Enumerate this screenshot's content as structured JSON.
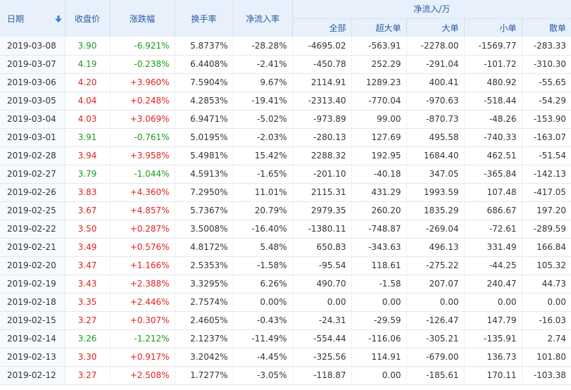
{
  "header": {
    "date": "日期",
    "close": "收盘价",
    "change": "涨跌幅",
    "turnover": "换手率",
    "ratio": "净流入率",
    "flow_group": "净流入/万",
    "flow_cols": [
      "全部",
      "超大单",
      "大单",
      "小单",
      "散单"
    ]
  },
  "rows": [
    {
      "date": "2019-03-08",
      "close": "3.90",
      "change": "-6.921%",
      "dir": "down",
      "turnover": "5.8737%",
      "ratio": "-28.28%",
      "all": "-4695.02",
      "xl": "-563.91",
      "l": "-2278.00",
      "s": "-1569.77",
      "r": "-283.33"
    },
    {
      "date": "2019-03-07",
      "close": "4.19",
      "change": "-0.238%",
      "dir": "down",
      "turnover": "6.4408%",
      "ratio": "-2.41%",
      "all": "-450.78",
      "xl": "252.29",
      "l": "-291.04",
      "s": "-101.72",
      "r": "-310.30"
    },
    {
      "date": "2019-03-06",
      "close": "4.20",
      "change": "+3.960%",
      "dir": "up",
      "turnover": "7.5904%",
      "ratio": "9.67%",
      "all": "2114.91",
      "xl": "1289.23",
      "l": "400.41",
      "s": "480.92",
      "r": "-55.65"
    },
    {
      "date": "2019-03-05",
      "close": "4.04",
      "change": "+0.248%",
      "dir": "up",
      "turnover": "4.2853%",
      "ratio": "-19.41%",
      "all": "-2313.40",
      "xl": "-770.04",
      "l": "-970.63",
      "s": "-518.44",
      "r": "-54.29"
    },
    {
      "date": "2019-03-04",
      "close": "4.03",
      "change": "+3.069%",
      "dir": "up",
      "turnover": "6.9471%",
      "ratio": "-5.02%",
      "all": "-973.89",
      "xl": "99.00",
      "l": "-870.73",
      "s": "-48.26",
      "r": "-153.90"
    },
    {
      "date": "2019-03-01",
      "close": "3.91",
      "change": "-0.761%",
      "dir": "down",
      "turnover": "5.0195%",
      "ratio": "-2.03%",
      "all": "-280.13",
      "xl": "127.69",
      "l": "495.58",
      "s": "-740.33",
      "r": "-163.07"
    },
    {
      "date": "2019-02-28",
      "close": "3.94",
      "change": "+3.958%",
      "dir": "up",
      "turnover": "5.4981%",
      "ratio": "15.42%",
      "all": "2288.32",
      "xl": "192.95",
      "l": "1684.40",
      "s": "462.51",
      "r": "-51.54"
    },
    {
      "date": "2019-02-27",
      "close": "3.79",
      "change": "-1.044%",
      "dir": "down",
      "turnover": "4.5913%",
      "ratio": "-1.65%",
      "all": "-201.10",
      "xl": "-40.18",
      "l": "347.05",
      "s": "-365.84",
      "r": "-142.13"
    },
    {
      "date": "2019-02-26",
      "close": "3.83",
      "change": "+4.360%",
      "dir": "up",
      "turnover": "7.2950%",
      "ratio": "11.01%",
      "all": "2115.31",
      "xl": "431.29",
      "l": "1993.59",
      "s": "107.48",
      "r": "-417.05"
    },
    {
      "date": "2019-02-25",
      "close": "3.67",
      "change": "+4.857%",
      "dir": "up",
      "turnover": "5.7367%",
      "ratio": "20.79%",
      "all": "2979.35",
      "xl": "260.20",
      "l": "1835.29",
      "s": "686.67",
      "r": "197.20"
    },
    {
      "date": "2019-02-22",
      "close": "3.50",
      "change": "+0.287%",
      "dir": "up",
      "turnover": "3.5008%",
      "ratio": "-16.40%",
      "all": "-1380.11",
      "xl": "-748.87",
      "l": "-269.04",
      "s": "-72.61",
      "r": "-289.59"
    },
    {
      "date": "2019-02-21",
      "close": "3.49",
      "change": "+0.576%",
      "dir": "up",
      "turnover": "4.8172%",
      "ratio": "5.48%",
      "all": "650.83",
      "xl": "-343.63",
      "l": "496.13",
      "s": "331.49",
      "r": "166.84"
    },
    {
      "date": "2019-02-20",
      "close": "3.47",
      "change": "+1.166%",
      "dir": "up",
      "turnover": "2.5353%",
      "ratio": "-1.58%",
      "all": "-95.54",
      "xl": "118.61",
      "l": "-275.22",
      "s": "-44.25",
      "r": "105.32"
    },
    {
      "date": "2019-02-19",
      "close": "3.43",
      "change": "+2.388%",
      "dir": "up",
      "turnover": "3.3295%",
      "ratio": "6.26%",
      "all": "490.70",
      "xl": "-1.58",
      "l": "207.07",
      "s": "240.47",
      "r": "44.73"
    },
    {
      "date": "2019-02-18",
      "close": "3.35",
      "change": "+2.446%",
      "dir": "up",
      "turnover": "2.7574%",
      "ratio": "0.00%",
      "all": "0.00",
      "xl": "0.00",
      "l": "0.00",
      "s": "0.00",
      "r": "0.00"
    },
    {
      "date": "2019-02-15",
      "close": "3.27",
      "change": "+0.307%",
      "dir": "up",
      "turnover": "2.4605%",
      "ratio": "-0.43%",
      "all": "-24.31",
      "xl": "-29.59",
      "l": "-126.47",
      "s": "147.79",
      "r": "-16.03"
    },
    {
      "date": "2019-02-14",
      "close": "3.26",
      "change": "-1.212%",
      "dir": "down",
      "turnover": "2.1237%",
      "ratio": "-11.49%",
      "all": "-554.44",
      "xl": "-116.06",
      "l": "-305.21",
      "s": "-135.91",
      "r": "2.74"
    },
    {
      "date": "2019-02-13",
      "close": "3.30",
      "change": "+0.917%",
      "dir": "up",
      "turnover": "3.2042%",
      "ratio": "-4.45%",
      "all": "-325.56",
      "xl": "114.91",
      "l": "-679.00",
      "s": "136.73",
      "r": "101.80"
    },
    {
      "date": "2019-02-12",
      "close": "3.27",
      "change": "+2.508%",
      "dir": "up",
      "turnover": "1.7277%",
      "ratio": "-3.05%",
      "all": "-118.87",
      "xl": "0.00",
      "l": "-185.61",
      "s": "170.11",
      "r": "-103.38"
    }
  ],
  "colors": {
    "up": "#e02020",
    "down": "#1a9a1a",
    "header_bg": "#e8f1fb",
    "header_text": "#2c5aa0"
  },
  "icons": {
    "sort": "sort-down-arrow-icon"
  }
}
